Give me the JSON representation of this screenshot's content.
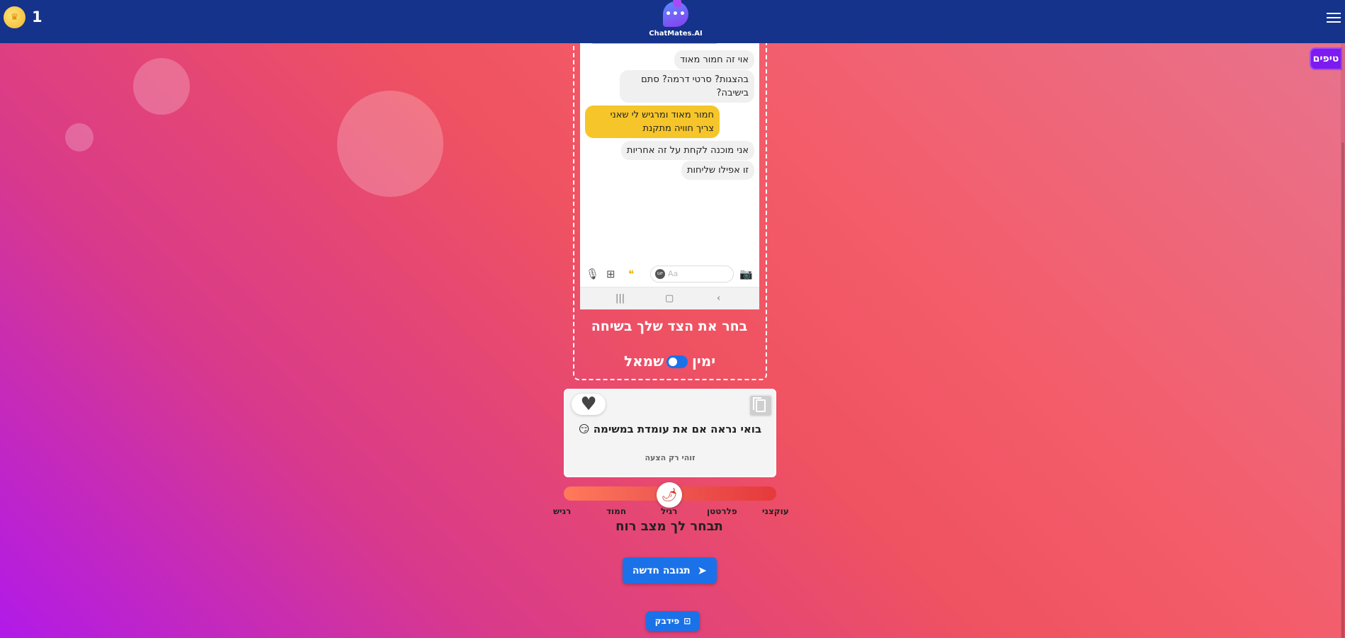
{
  "header": {
    "coins": "1",
    "coin_icon": "crown-icon",
    "logo_text": "ChatMates.AI",
    "logo_dots": "•••"
  },
  "tips_label": "טיפים",
  "chat": {
    "messages": [
      {
        "text": "אוי זה חמור מאוד",
        "mine": false
      },
      {
        "text": "בהצגות? סרטי דרמה? סתם בישיבה?",
        "mine": false
      },
      {
        "text": "חמור מאוד ומרגיש לי שאני צריך חוויה מתקנת",
        "mine": true
      },
      {
        "text": "אני מוכנה לקחת על זה אחריות",
        "mine": false
      },
      {
        "text": "זו אפילו שליחות",
        "mine": false
      }
    ],
    "composer_placeholder": "Aa",
    "gif_label": "GIF"
  },
  "side_picker": {
    "title": "בחר את הצד שלך בשיחה",
    "right_label": "ימין",
    "left_label": "שמאל"
  },
  "suggestion": {
    "text": "בואי נראה אם את עומדת במשימה 😏",
    "note": "זוהי רק הצעה"
  },
  "mood": {
    "options": [
      "עוקצני",
      "פלרטטן",
      "רגיל",
      "חמוד",
      "רגיש"
    ],
    "selected": "רגיל",
    "title": "תבחר לך מצב רוח",
    "knob_icon": "🌶"
  },
  "buttons": {
    "new_reply": "תגובה חדשה",
    "feedback": "פידבק"
  },
  "colors": {
    "header_bg": "#15338b",
    "accent_blue": "#1b72e8",
    "tips_purple": "#7c1af0",
    "my_bubble": "#f5c52a"
  }
}
